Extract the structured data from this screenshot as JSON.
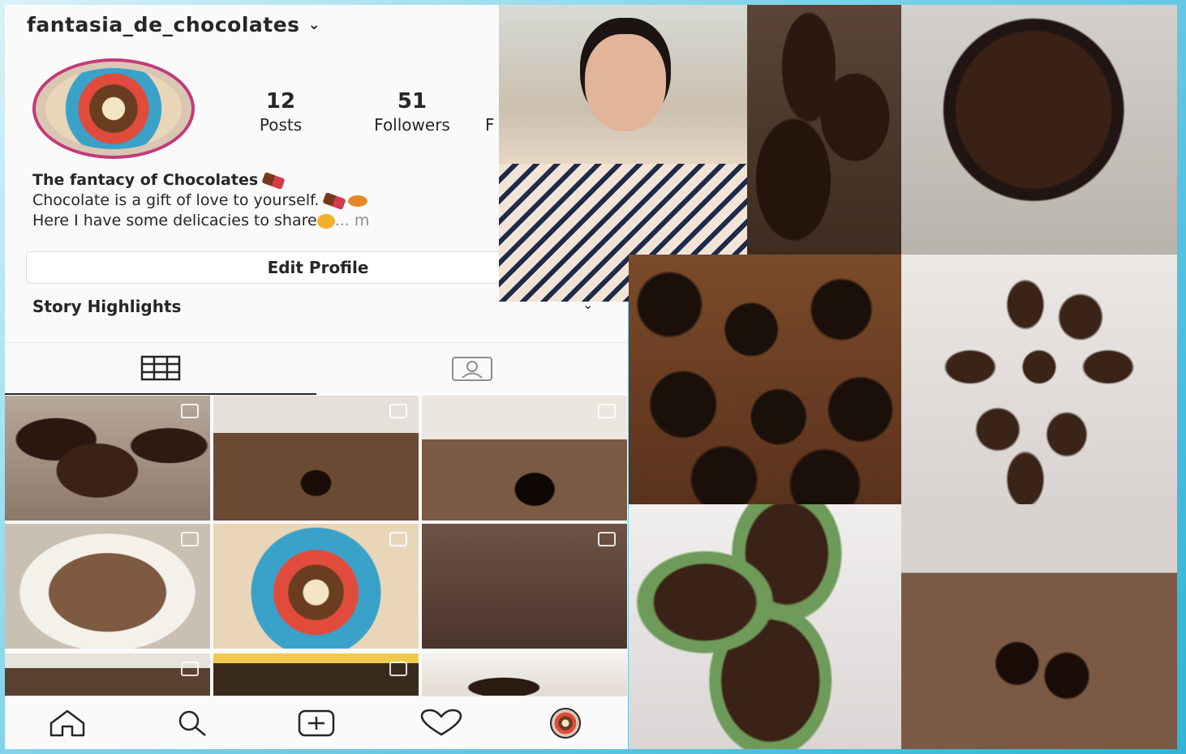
{
  "profile": {
    "username": "fantasia_de_chocolates",
    "posts_count": "12",
    "posts_label": "Posts",
    "followers_count": "51",
    "followers_label": "Followers",
    "following_label_partial": "F",
    "bio_name": "The fantacy of Chocolates",
    "bio_line1": "Chocolate is a gift of love to yourself.",
    "bio_line2": "Here I have some delicacies to share",
    "bio_more": "... m",
    "edit_profile_label": "Edit Profile",
    "story_highlights_label": "Story Highlights"
  },
  "icons": {
    "username_dropdown": "chevron-down-icon",
    "highlights_toggle": "chevron-down-icon",
    "grid_tab": "grid-icon",
    "tagged_tab": "tagged-person-icon",
    "home": "home-icon",
    "search": "search-icon",
    "new_post": "plus-square-icon",
    "activity": "heart-icon",
    "profile": "avatar-icon"
  },
  "colors": {
    "avatar_ring": "#c23b7a",
    "text_primary": "#262626",
    "border": "#dbdbdb"
  }
}
